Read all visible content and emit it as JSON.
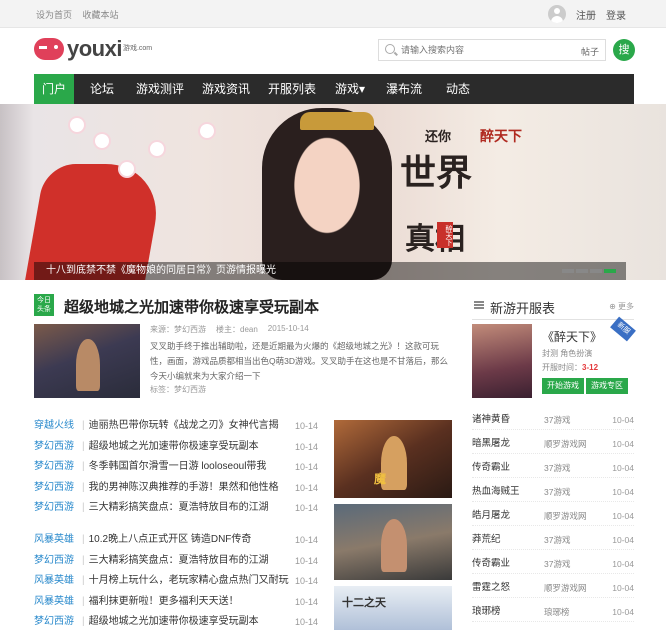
{
  "topbar": {
    "set_home": "设为首页",
    "bookmark": "收藏本站",
    "register": "注册",
    "login": "登录"
  },
  "header": {
    "logo_text": "youxi",
    "logo_sub": "游戏.com",
    "search_placeholder": "请输入搜索内容",
    "search_type": "帖子",
    "search_button": "搜"
  },
  "nav": {
    "items": [
      "门户",
      "论坛",
      "游戏测评",
      "游戏资讯",
      "开服列表",
      "游戏▾",
      "瀑布流",
      "动态"
    ],
    "active_index": 0,
    "accent": "#2aa84a"
  },
  "banner": {
    "caption": "十八到底禁不禁《魔物娘的同居日常》页游情报曝光",
    "calligraphy_1": "世界",
    "calligraphy_2": "真相",
    "small_1": "还你",
    "stamp": "醉天下",
    "game_logo": "醉天下"
  },
  "feature": {
    "tag_line1": "今日",
    "tag_line2": "头条",
    "title": "超级地城之光加速带你极速享受玩副本",
    "source": "来源：梦幻西游",
    "author": "楼主：dean",
    "date": "2015-10-14",
    "excerpt": "叉叉助手终于推出辅助啦，还是近期最为火爆的《超级地城之光》！这款可玩性，画面，游戏品质都相当出色Q萌3D游戏。叉叉助手在这也是不甘落后，那么今天小编就来为大家介绍一下",
    "tags": "标签：梦幻西游"
  },
  "news_list": [
    {
      "category": "穿越火线",
      "title": "迪丽热巴带你玩转《战龙之刃》女神代言揭",
      "date": "10-14"
    },
    {
      "category": "梦幻西游",
      "title": "超级地城之光加速带你极速享受玩副本",
      "date": "10-14"
    },
    {
      "category": "梦幻西游",
      "title": "冬季韩国首尔滑雪一日游 looloseoul带我",
      "date": "10-14"
    },
    {
      "category": "梦幻西游",
      "title": "我的男神陈汉典推荐的手游！果然和他性格",
      "date": "10-14"
    },
    {
      "category": "梦幻西游",
      "title": "三大精彩搞笑盘点：夏浩特放目布的江湖",
      "date": "10-14"
    }
  ],
  "news_list_2": [
    {
      "category": "风暴英雄",
      "title": "10.2晚上八点正式开区 铸造DNF传奇",
      "date": "10-14"
    },
    {
      "category": "梦幻西游",
      "title": "三大精彩搞笑盘点：夏浩特放目布的江湖",
      "date": "10-14"
    },
    {
      "category": "风暴英雄",
      "title": "十月榜上玩什么，老玩家精心盘点热门又耐玩",
      "date": "10-14"
    },
    {
      "category": "风暴英雄",
      "title": "福利抹更新啦！更多福利天天送！",
      "date": "10-14"
    },
    {
      "category": "梦幻西游",
      "title": "超级地城之光加速带你极速享受玩副本",
      "date": "10-14"
    }
  ],
  "side_thumbs": [
    "魔",
    "",
    "十二之天"
  ],
  "sidebar": {
    "title": "新游开服表",
    "more": "更多",
    "game": {
      "name": "《醉天下》",
      "genre": "封测  角色扮演",
      "time_label": "开服时间：",
      "time": "3-12",
      "btn_start": "开始游戏",
      "btn_zone": "游戏专区",
      "badge": "新服"
    },
    "rows": [
      {
        "name": "诸神黄昏",
        "platform": "37游戏",
        "date": "10-04"
      },
      {
        "name": "暗黑屠龙",
        "platform": "顺罗游戏网",
        "date": "10-04"
      },
      {
        "name": "传奇霸业",
        "platform": "37游戏",
        "date": "10-04"
      },
      {
        "name": "热血海贼王",
        "platform": "37游戏",
        "date": "10-04"
      },
      {
        "name": "皓月屠龙",
        "platform": "顺罗游戏网",
        "date": "10-04"
      },
      {
        "name": "莽荒纪",
        "platform": "37游戏",
        "date": "10-04"
      },
      {
        "name": "传奇霸业",
        "platform": "37游戏",
        "date": "10-04"
      },
      {
        "name": "雷霆之怒",
        "platform": "顺罗游戏网",
        "date": "10-04"
      },
      {
        "name": "琅琊榜",
        "platform": "琅琊榜",
        "date": "10-04"
      }
    ]
  }
}
